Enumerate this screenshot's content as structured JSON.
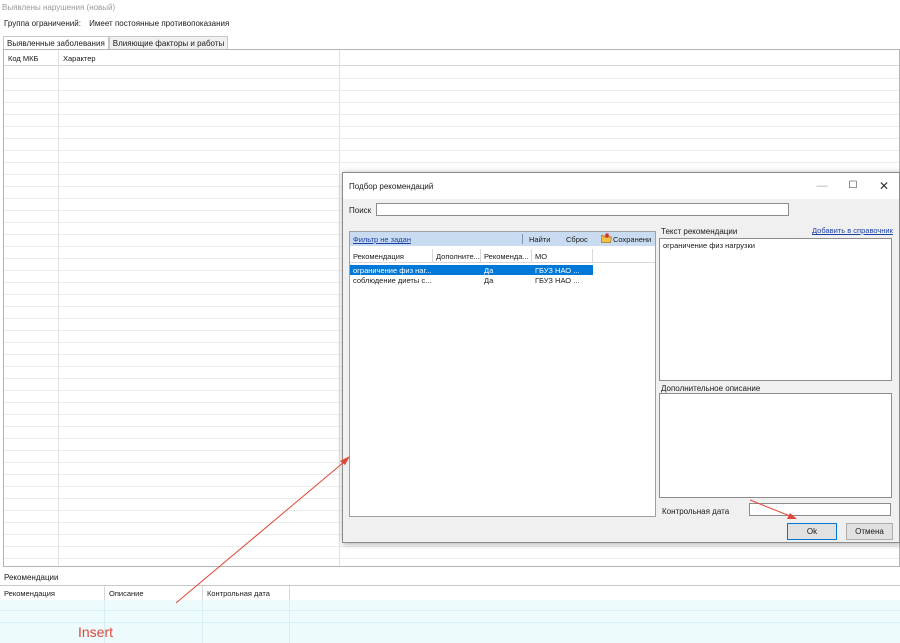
{
  "window": {
    "title": "Выявлены нарушения (новый)"
  },
  "group": {
    "label": "Группа ограничений:",
    "value": "Имеет постоянные противопоказания"
  },
  "tabs": [
    {
      "label": "Выявленные заболевания",
      "active": true
    },
    {
      "label": "Влияющие факторы и работы",
      "active": false
    }
  ],
  "main_grid": {
    "columns": [
      "Код МКБ",
      "Характер"
    ]
  },
  "recommendations": {
    "label": "Рекомендации",
    "columns": [
      "Рекомендация",
      "Описание",
      "Контрольная дата"
    ]
  },
  "annotation": {
    "insert_text": "Insert",
    "color": "#e0463a"
  },
  "dialog": {
    "title": "Подбор рекомендаций",
    "controls": {
      "minimize": "—",
      "maximize": "☐",
      "close": "✕"
    },
    "search": {
      "label": "Поиск",
      "value": ""
    },
    "filter_bar": {
      "filter_link": "Фильтр не задан",
      "find": "Найти",
      "reset": "Сброс",
      "save": "Сохранени"
    },
    "list": {
      "columns": [
        "Рекомендация",
        "Дополните...",
        "Рекоменда...",
        "МО"
      ],
      "rows": [
        {
          "rec": "ограничение физ наг...",
          "extra": "",
          "recommended": "Да",
          "mo": "ГБУЗ НАО ...",
          "selected": true
        },
        {
          "rec": "соблюдение диеты с...",
          "extra": "",
          "recommended": "Да",
          "mo": "ГБУЗ НАО ...",
          "selected": false
        }
      ]
    },
    "text_label": "Текст рекомендации",
    "add_link": "Добавить в справочник",
    "text_value": "ограничение физ нагрузки",
    "desc_label": "Дополнительное описание",
    "date_label": "Контрольная дата",
    "ok": "Ok",
    "cancel": "Отмена",
    "selection_color": "#0078d7"
  }
}
